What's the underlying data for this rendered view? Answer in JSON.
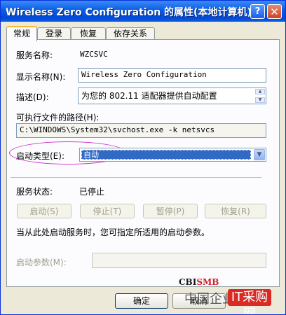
{
  "window": {
    "title": "Wireless Zero Configuration 的属性(本地计算机)"
  },
  "tabs": [
    {
      "label": "常规"
    },
    {
      "label": "登录"
    },
    {
      "label": "恢复"
    },
    {
      "label": "依存关系"
    }
  ],
  "general": {
    "service_name_label": "服务名称:",
    "service_name": "WZCSVC",
    "display_name_label": "显示名称(N):",
    "display_name": "Wireless Zero Configuration",
    "description_label": "描述(D):",
    "description": "为您的 802.11 适配器提供自动配置",
    "exe_path_label": "可执行文件的路径(H):",
    "exe_path": "C:\\WINDOWS\\System32\\svchost.exe -k netsvcs",
    "startup_type_label": "启动类型(E):",
    "startup_type": "自动",
    "service_status_label": "服务状态:",
    "service_status": "已停止",
    "buttons": {
      "start": "启动(S)",
      "stop": "停止(T)",
      "pause": "暂停(P)",
      "resume": "恢复(R)"
    },
    "hint": "当从此处启动服务时，您可指定所适用的启动参数。",
    "start_params_label": "启动参数(M):",
    "start_params": ""
  },
  "footer": {
    "ok": "确定",
    "cancel": "取消"
  },
  "watermark": {
    "cbi": "CBI",
    "smb": "SMB",
    "site_left": "中国企业",
    "site_right": "IT采购网"
  },
  "colors": {
    "titlebar": "#0a5de4",
    "selection": "#316ac5",
    "annotation": "#cc33cc"
  }
}
